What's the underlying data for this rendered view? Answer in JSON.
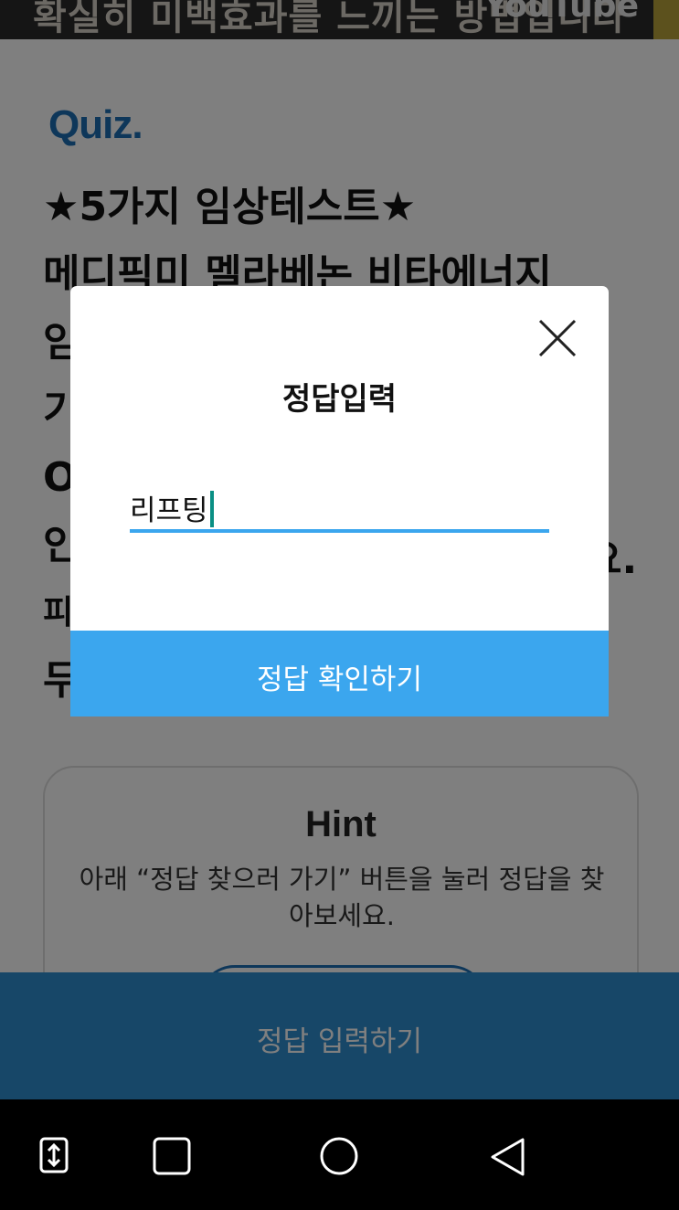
{
  "video": {
    "caption": "확실히 미백효과를 느끼는 방법입니다",
    "logo": "YouTube"
  },
  "quiz": {
    "label": "Quiz.",
    "question_lines": [
      "★5가지 임상테스트★",
      "메디픽미 멜라베논 비타에너지",
      "임",
      "기",
      "O",
      "인",
      "피",
      "두"
    ],
    "question_right_fragment": "요."
  },
  "hint": {
    "title": "Hint",
    "text": "아래 “정답 찾으러 가기” 버튼을 눌러 정답을 찾아보세요."
  },
  "bottom_bar": {
    "label": "정답 입력하기"
  },
  "modal": {
    "title": "정답입력",
    "answer_value": "리프팅",
    "submit_label": "정답 확인하기"
  },
  "navbar": {
    "icons": [
      "screen-adjust-icon",
      "recent-apps-icon",
      "home-icon",
      "back-icon"
    ]
  },
  "colors": {
    "accent_blue": "#3ba6ee",
    "quiz_blue": "#1d6fb5",
    "bottom_bar": "#2f8ed0",
    "cursor": "#0a8f84"
  }
}
